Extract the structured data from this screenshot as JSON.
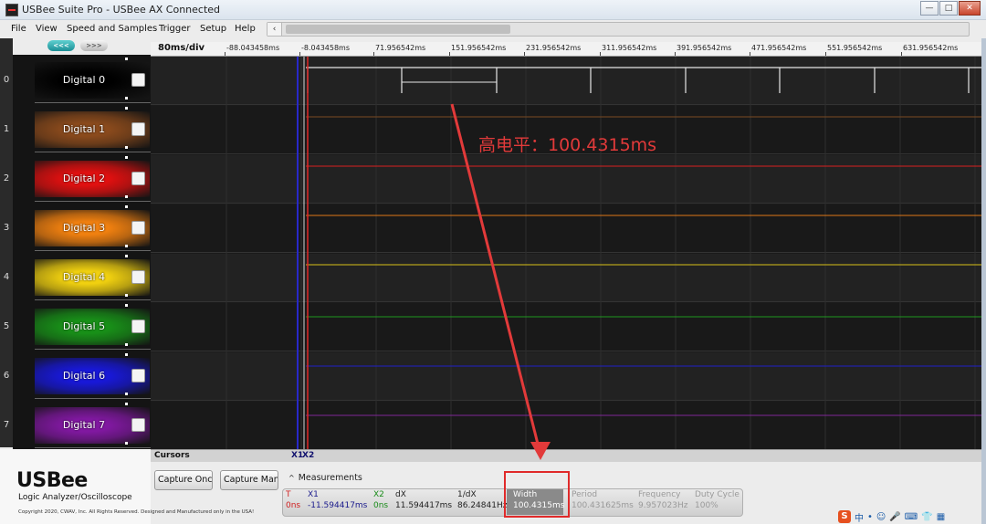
{
  "window": {
    "title": "USBee Suite Pro - USBee AX Connected"
  },
  "menu": [
    "File",
    "View",
    "Speed and Samples",
    "Trigger",
    "Setup",
    "Help"
  ],
  "speed": {
    "slower": "<<<",
    "faster": ">>>"
  },
  "channels": [
    {
      "index": "0",
      "name": "Digital 0",
      "color": "#1a1a1a"
    },
    {
      "index": "1",
      "name": "Digital 1",
      "color": "#8a4a1c"
    },
    {
      "index": "2",
      "name": "Digital 2",
      "color": "#e01010"
    },
    {
      "index": "3",
      "name": "Digital 3",
      "color": "#f08010"
    },
    {
      "index": "4",
      "name": "Digital 4",
      "color": "#f0d010"
    },
    {
      "index": "5",
      "name": "Digital 5",
      "color": "#189018"
    },
    {
      "index": "6",
      "name": "Digital 6",
      "color": "#1818d8"
    },
    {
      "index": "7",
      "name": "Digital 7",
      "color": "#8018a0"
    }
  ],
  "timebase": {
    "div": "80ms/div",
    "ticks": [
      "-88.043458ms",
      "-8.043458ms",
      "71.956542ms",
      "151.956542ms",
      "231.956542ms",
      "311.956542ms",
      "391.956542ms",
      "471.956542ms",
      "551.956542ms",
      "631.956542ms"
    ]
  },
  "cursors": {
    "label": "Cursors",
    "x1": "X1",
    "x2": "X2"
  },
  "buttons": {
    "capture_once": "Capture Once",
    "capture_many": "Capture Many"
  },
  "measurements": {
    "title": "Measurements",
    "cols": [
      {
        "h": "T",
        "v": "0ns",
        "hcolor": "#d02020",
        "vcolor": "#d02020"
      },
      {
        "h": "X1",
        "v": "-11.594417ms",
        "hcolor": "#1a1a8c",
        "vcolor": "#1a1a8c"
      },
      {
        "h": "X2",
        "v": "0ns",
        "hcolor": "#1a8c1a",
        "vcolor": "#1a8c1a"
      },
      {
        "h": "dX",
        "v": "11.594417ms",
        "hcolor": "#222222",
        "vcolor": "#222222"
      },
      {
        "h": "1/dX",
        "v": "86.24841Hz",
        "hcolor": "#222222",
        "vcolor": "#222222"
      },
      {
        "h": "Width",
        "v": "100.4315ms",
        "hcolor": "#ffffff",
        "vcolor": "#ffffff"
      },
      {
        "h": "Period",
        "v": "100.431625ms",
        "hcolor": "#9a9a9a",
        "vcolor": "#9a9a9a"
      },
      {
        "h": "Frequency",
        "v": "9.957023Hz",
        "hcolor": "#9a9a9a",
        "vcolor": "#9a9a9a"
      },
      {
        "h": "Duty Cycle",
        "v": "100%",
        "hcolor": "#9a9a9a",
        "vcolor": "#9a9a9a"
      }
    ]
  },
  "annotation": "高电平：100.4315ms",
  "brand": {
    "name": "USBee",
    "subtitle": "Logic Analyzer/Oscilloscope",
    "copyright": "Copyright 2020, CWAV, Inc. All Rights Reserved. Designed and Manufactured only in the USA!"
  },
  "tray": [
    "S",
    "中",
    "•",
    "☺",
    "🎤",
    "⌨",
    "👕",
    "▦"
  ]
}
